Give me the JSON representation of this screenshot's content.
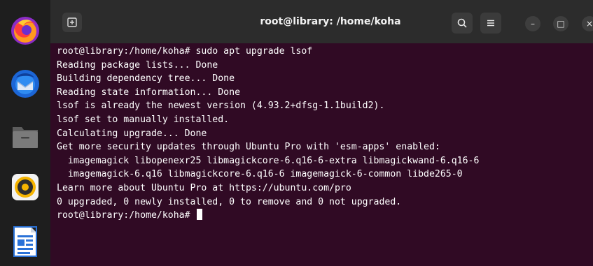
{
  "dock": {
    "items": [
      {
        "name": "firefox-icon"
      },
      {
        "name": "thunderbird-icon"
      },
      {
        "name": "files-icon"
      },
      {
        "name": "rhythmbox-icon"
      },
      {
        "name": "libreoffice-writer-icon"
      }
    ]
  },
  "window": {
    "title": "root@library: /home/koha",
    "buttons": {
      "new_tab": "new-tab-icon",
      "search": "search-icon",
      "menu": "hamburger-menu-icon",
      "minimize": "–",
      "maximize": "□",
      "close": "×"
    }
  },
  "terminal": {
    "lines": [
      "root@library:/home/koha# sudo apt upgrade lsof",
      "Reading package lists... Done",
      "Building dependency tree... Done",
      "Reading state information... Done",
      "lsof is already the newest version (4.93.2+dfsg-1.1build2).",
      "lsof set to manually installed.",
      "Calculating upgrade... Done",
      "Get more security updates through Ubuntu Pro with 'esm-apps' enabled:",
      "  imagemagick libopenexr25 libmagickcore-6.q16-6-extra libmagickwand-6.q16-6",
      "  imagemagick-6.q16 libmagickcore-6.q16-6 imagemagick-6-common libde265-0",
      "Learn more about Ubuntu Pro at https://ubuntu.com/pro",
      "0 upgraded, 0 newly installed, 0 to remove and 0 not upgraded."
    ],
    "prompt": "root@library:/home/koha# "
  },
  "colors": {
    "terminal_bg": "#300a24",
    "dock_bg": "#1e1e1e",
    "titlebar_bg": "#2c2c2c",
    "text": "#ffffff"
  }
}
